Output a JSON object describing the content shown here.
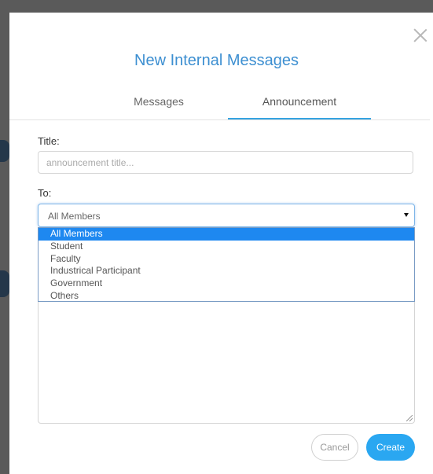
{
  "dialog": {
    "title": "New Internal Messages"
  },
  "tabs": [
    {
      "label": "Messages"
    },
    {
      "label": "Announcement",
      "active": true
    }
  ],
  "form": {
    "title_label": "Title:",
    "title_placeholder": "announcement title...",
    "to_label": "To:",
    "to_selected": "All Members",
    "to_options": [
      "All Members",
      "Student",
      "Faculty",
      "Industrical Participant",
      "Government",
      "Others"
    ]
  },
  "buttons": {
    "cancel": "Cancel",
    "create": "Create"
  },
  "colors": {
    "accent": "#35a3e0",
    "title": "#3d8fd1",
    "selected_option": "#1e88f0",
    "create_button": "#2aa7f1"
  }
}
